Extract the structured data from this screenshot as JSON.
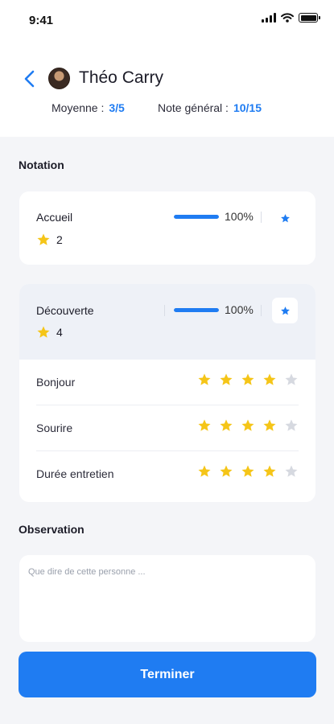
{
  "status": {
    "time": "9:41"
  },
  "profile": {
    "name": "Théo Carry",
    "average_label": "Moyenne :",
    "average_value": "3/5",
    "overall_label": "Note général :",
    "overall_value": "10/15"
  },
  "notation": {
    "title": "Notation",
    "items": [
      {
        "label": "Accueil",
        "score": "2",
        "progress_percent": 100,
        "progress_text": "100%"
      },
      {
        "label": "Découverte",
        "score": "4",
        "progress_percent": 100,
        "progress_text": "100%",
        "criteria": [
          {
            "label": "Bonjour",
            "rating": 4,
            "max": 5
          },
          {
            "label": "Sourire",
            "rating": 4,
            "max": 5
          },
          {
            "label": "Durée entretien",
            "rating": 4,
            "max": 5
          }
        ]
      }
    ]
  },
  "observation": {
    "title": "Observation",
    "placeholder": "Que dire de cette personne ..."
  },
  "submit_label": "Terminer",
  "colors": {
    "accent": "#1f7cf2",
    "star": "#f5c518",
    "star_empty": "#d6d9e0"
  }
}
